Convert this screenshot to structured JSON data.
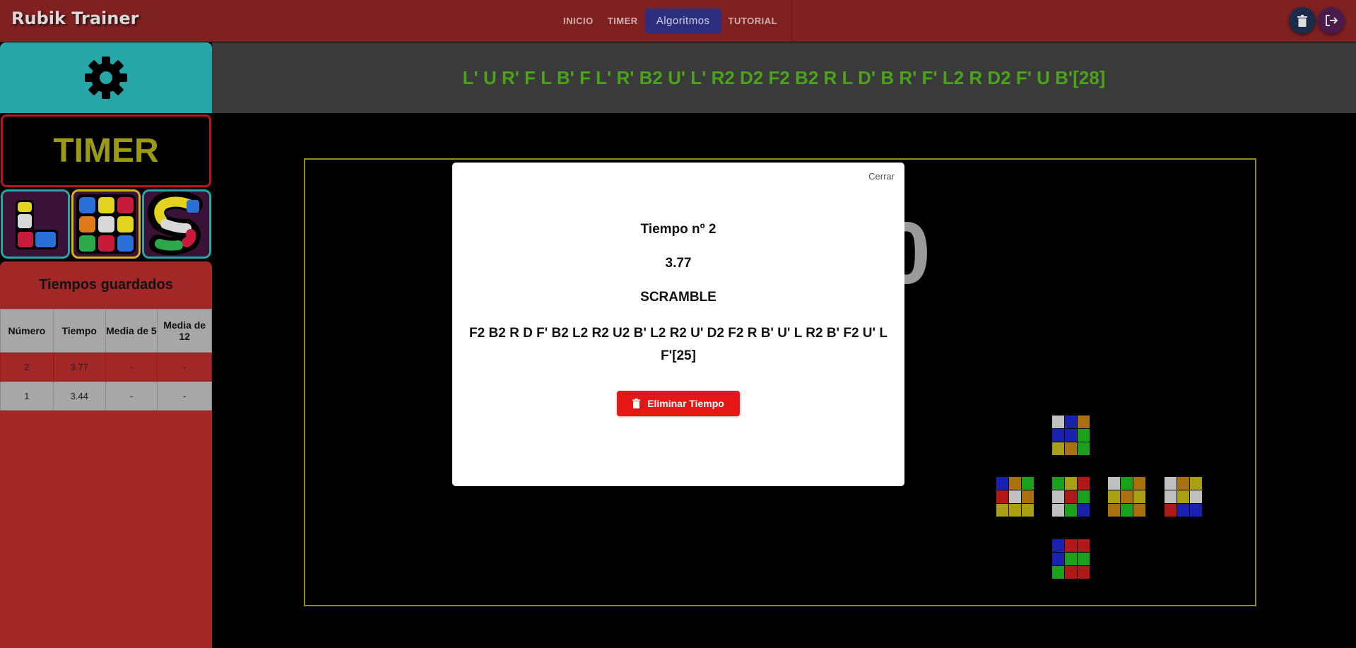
{
  "header": {
    "title": "Rubik Trainer",
    "nav": [
      {
        "label": "INICIO",
        "active": false
      },
      {
        "label": "TIMER",
        "active": false
      },
      {
        "label": "Algoritmos",
        "active": true
      },
      {
        "label": "TUTORIAL",
        "active": false
      }
    ],
    "actions": {
      "delete_icon": "trash-icon",
      "logout_icon": "logout-icon"
    }
  },
  "sidebar": {
    "settings_icon": "gear-icon",
    "timer_label": "TIMER",
    "modes": [
      "mode-l",
      "mode-cube",
      "mode-s"
    ],
    "saved_times_title": "Tiempos guardados",
    "table": {
      "headers": [
        "Número",
        "Tiempo",
        "Media de 5",
        "Media de 12"
      ],
      "rows": [
        [
          "2",
          "3.77",
          "-",
          "-"
        ],
        [
          "1",
          "3.44",
          "-",
          "-"
        ]
      ]
    }
  },
  "scramble": "L' U R' F L B' F L' R' B2 U' L' R2 D2 F2 B2 R L D' B R' F' L2 R D2 F' U B'[28]",
  "timer_display": "0",
  "modal": {
    "close_label": "Cerrar",
    "heading": "Tiempo nº 2",
    "time": "3.77",
    "scramble_label": "SCRAMBLE",
    "scramble_text": "F2 B2 R D F' B2 L2 R2 U2 B' L2 R2 U' D2 F2 R B' U' L R2 B' F2 U' L F'[25]",
    "delete_label": "Eliminar Tiempo"
  },
  "colors": {
    "header_bg": "#7f2121",
    "accent_teal": "#26a6a6",
    "scramble_green": "#4ba21b",
    "delete_red": "#e51616"
  }
}
